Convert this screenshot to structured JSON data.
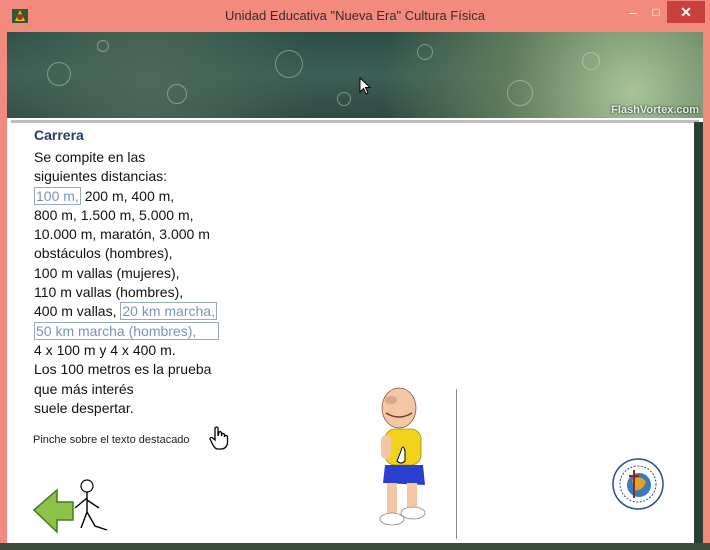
{
  "window": {
    "title": "Unidad Educativa \"Nueva Era\" Cultura Física",
    "minimize_glyph": "–",
    "maximize_glyph": "□",
    "close_glyph": "✕"
  },
  "banner": {
    "watermark": "FlashVortex.com"
  },
  "content": {
    "heading": "Carrera",
    "lines": [
      "Se compite en las",
      "siguientes distancias:",
      "100 m,",
      " 200 m, 400 m,",
      "800 m, 1.500 m, 5.000 m,",
      "10.000 m, maratón, 3.000 m",
      "obstáculos (hombres),",
      "100 m vallas (mujeres),",
      "110 m vallas (hombres),",
      "400 m vallas,",
      "20 km marcha,",
      "50 km marcha (hombres),",
      "4 x 100 m y 4 x 400 m.",
      "Los 100 metros es la prueba",
      "que más interés",
      "suele despertar."
    ],
    "hint": "Pinche sobre el texto destacado"
  },
  "colors": {
    "titlebar": "#f28b7e",
    "close": "#c9413a",
    "heading": "#1f3f6e",
    "highlight_link": "#7b93b9",
    "runner_shirt": "#f2d21a",
    "runner_shorts": "#2a3fd0",
    "back_arrow": "#8bc34a"
  }
}
